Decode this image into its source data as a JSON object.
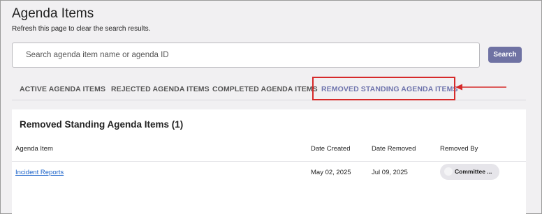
{
  "header": {
    "title": "Agenda Items",
    "subtitle": "Refresh this page to clear the search results."
  },
  "search": {
    "placeholder": "Search agenda item name or agenda ID",
    "value": "",
    "button_label": "Search"
  },
  "tabs": [
    {
      "label": "ACTIVE AGENDA ITEMS",
      "selected": false
    },
    {
      "label": "REJECTED AGENDA ITEMS",
      "selected": false
    },
    {
      "label": "COMPLETED AGENDA ITEMS",
      "selected": false
    },
    {
      "label": "REMOVED STANDING AGENDA ITEMS",
      "selected": true
    }
  ],
  "annotation": {
    "highlight_color": "#d62a2a",
    "pointer": "arrow-left-icon"
  },
  "panel": {
    "title": "Removed Standing Agenda Items (1)",
    "columns": [
      "Agenda Item",
      "Date Created",
      "Date Removed",
      "Removed By"
    ],
    "rows": [
      {
        "agenda_item": "Incident Reports",
        "date_created": "May 02, 2025",
        "date_removed": "Jul 09, 2025",
        "removed_by": "Committee ..."
      }
    ]
  },
  "colors": {
    "accent": "#6f72a3",
    "selected_tab": "#6f74ad",
    "link": "#1a62c9",
    "background": "#f1f0f2"
  }
}
